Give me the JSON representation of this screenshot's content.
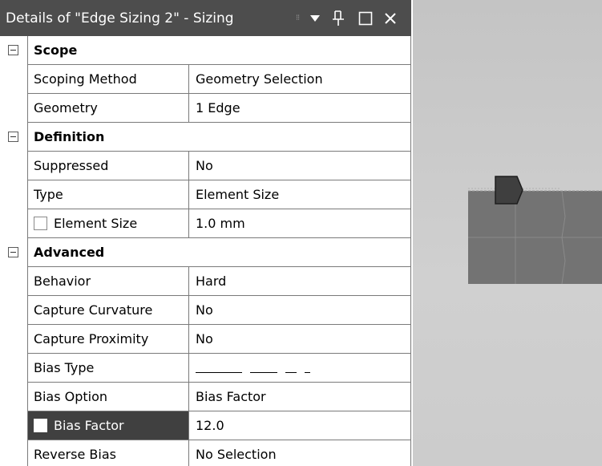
{
  "panel": {
    "title": "Details of \"Edge Sizing 2\" - Sizing"
  },
  "titlebar_buttons": {
    "grip_icon": "drag-grip-icon",
    "dropdown_glyph": "▼",
    "pin_glyph": "Ţ",
    "maximize_glyph": "☐",
    "close_glyph": "✕"
  },
  "sections": {
    "scope": {
      "label": "Scope",
      "rows": {
        "scoping_method": {
          "name": "Scoping Method",
          "value": "Geometry Selection"
        },
        "geometry": {
          "name": "Geometry",
          "value": "1 Edge"
        }
      }
    },
    "definition": {
      "label": "Definition",
      "rows": {
        "suppressed": {
          "name": "Suppressed",
          "value": "No"
        },
        "type": {
          "name": "Type",
          "value": "Element Size"
        },
        "element_size": {
          "name": "Element Size",
          "value": "1.0 mm"
        }
      }
    },
    "advanced": {
      "label": "Advanced",
      "rows": {
        "behavior": {
          "name": "Behavior",
          "value": "Hard"
        },
        "capture_curvature": {
          "name": "Capture Curvature",
          "value": "No"
        },
        "capture_proximity": {
          "name": "Capture Proximity",
          "value": "No"
        },
        "bias_type": {
          "name": "Bias Type",
          "value": ""
        },
        "bias_option": {
          "name": "Bias Option",
          "value": "Bias Factor"
        },
        "bias_factor": {
          "name": "Bias Factor",
          "value": "12.0"
        },
        "reverse_bias": {
          "name": "Reverse Bias",
          "value": "No Selection"
        }
      }
    }
  },
  "colors": {
    "titlebar_bg": "#4d4d4d",
    "selected_row_bg": "#404040",
    "grid_line": "#7a7a7a",
    "viewport_bg": "#c8c8c8",
    "mesh_fill": "#737373",
    "vertex_marker": "#3f3f3f"
  }
}
